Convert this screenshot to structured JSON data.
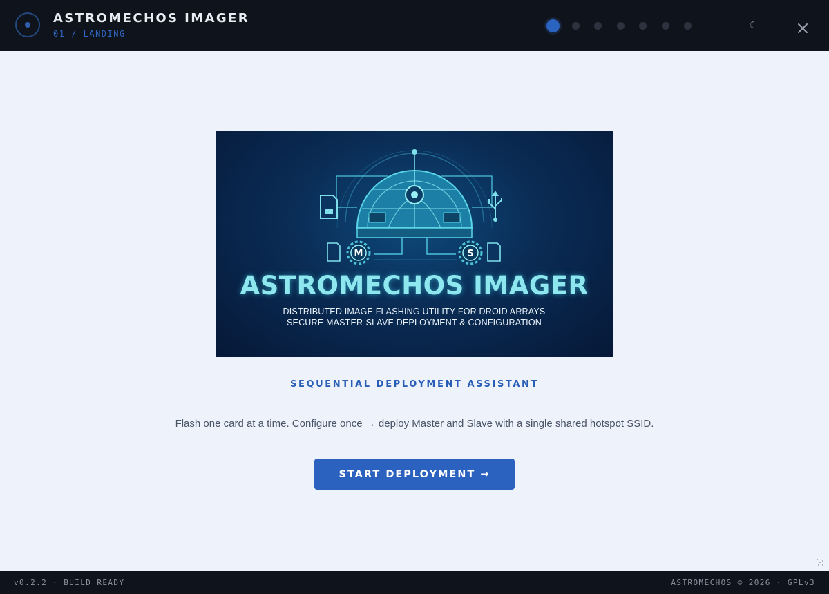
{
  "header": {
    "title": "ASTROMECHOS IMAGER",
    "subtitle": "01 / LANDING",
    "steps": [
      {
        "state": "active"
      },
      {
        "state": "inactive"
      },
      {
        "state": "inactive"
      },
      {
        "state": "inactive"
      },
      {
        "state": "inactive"
      },
      {
        "state": "inactive"
      },
      {
        "state": "inactive"
      }
    ],
    "theme_toggle_glyph": "☾",
    "close_glyph": "×"
  },
  "hero": {
    "title": "ASTROMECHOS IMAGER",
    "tagline_1": "DISTRIBUTED IMAGE FLASHING UTILITY FOR DROID ARRAYS",
    "tagline_2": "SECURE MASTER-SLAVE DEPLOYMENT & CONFIGURATION",
    "node_master": "M",
    "node_slave": "S"
  },
  "main": {
    "heading": "SEQUENTIAL DEPLOYMENT ASSISTANT",
    "description": "Flash one card at a time. Configure once → deploy Master and Slave with a single shared hotspot SSID.",
    "cta_label": "START DEPLOYMENT →"
  },
  "footer": {
    "left": "v0.2.2 · BUILD READY",
    "right": "ASTROMECHOS © 2026 · GPLv3"
  },
  "colors": {
    "header_bg": "#0f131b",
    "page_bg": "#eef2fa",
    "accent": "#2b62bf",
    "hero_cyan": "#8ee6ef"
  },
  "icons": [
    "app-logo-icon",
    "moon-icon",
    "close-icon",
    "sd-card-icon",
    "usb-icon",
    "gear-icon",
    "resize-grip-icon"
  ]
}
